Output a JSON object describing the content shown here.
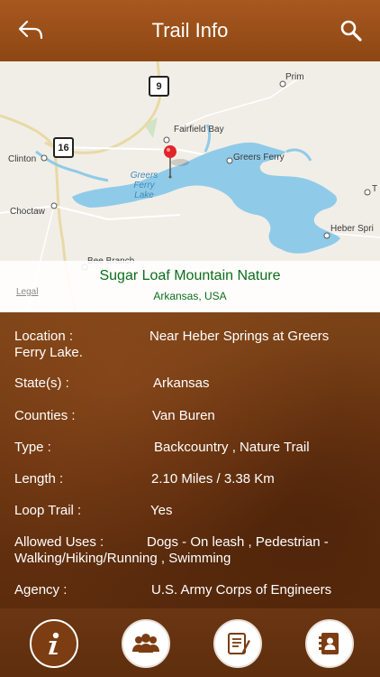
{
  "header": {
    "title": "Trail Info"
  },
  "map": {
    "places": [
      "Prim",
      "Fairfield Bay",
      "Clinton",
      "Greers Ferry",
      "Choctaw",
      "Heber Spri",
      "Bee Branch",
      "T"
    ],
    "lake": [
      "Greers",
      "Ferry",
      "Lake"
    ],
    "shields": [
      "9",
      "16"
    ],
    "legal": "Legal"
  },
  "callout": {
    "name": "Sugar Loaf Mountain Nature",
    "location": "Arkansas, USA"
  },
  "details": [
    {
      "label": "Location   :",
      "value": "Near Heber Springs at Greers",
      "cont": "Ferry Lake."
    },
    {
      "label": "State(s)  :",
      "value": "Arkansas"
    },
    {
      "label": "Counties  :",
      "value": "Van Buren"
    },
    {
      "label": "Type  :",
      "value": "Backcountry , Nature Trail"
    },
    {
      "label": "Length  :",
      "value": "2.10 Miles / 3.38 Km"
    },
    {
      "label": "Loop Trail  :",
      "value": "Yes"
    },
    {
      "label": "Allowed Uses  :",
      "value": "Dogs - On leash , Pedestrian -",
      "cont": "Walking/Hiking/Running , Swimming"
    },
    {
      "label": "Agency  :",
      "value": "U.S. Army Corps of Engineers"
    }
  ],
  "tabs": [
    "info-icon",
    "group-icon",
    "notes-icon",
    "contacts-icon"
  ],
  "colors": {
    "header": "#9c5019",
    "trail_name": "#0b6e1a",
    "lake": "#8fcbe8"
  }
}
